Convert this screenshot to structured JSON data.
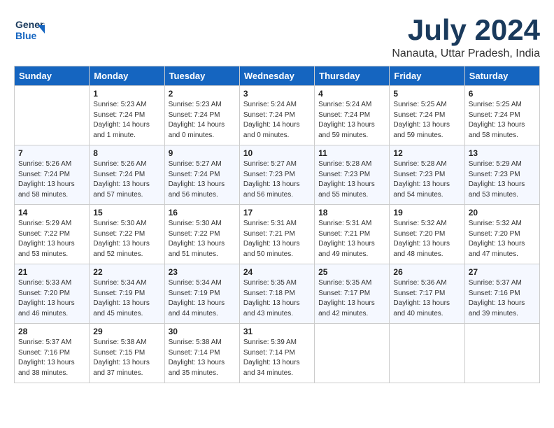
{
  "header": {
    "logo_line1": "General",
    "logo_line2": "Blue",
    "title": "July 2024",
    "subtitle": "Nanauta, Uttar Pradesh, India"
  },
  "columns": [
    "Sunday",
    "Monday",
    "Tuesday",
    "Wednesday",
    "Thursday",
    "Friday",
    "Saturday"
  ],
  "weeks": [
    [
      {
        "num": "",
        "sunrise": "",
        "sunset": "",
        "daylight": ""
      },
      {
        "num": "1",
        "sunrise": "Sunrise: 5:23 AM",
        "sunset": "Sunset: 7:24 PM",
        "daylight": "Daylight: 14 hours and 1 minute."
      },
      {
        "num": "2",
        "sunrise": "Sunrise: 5:23 AM",
        "sunset": "Sunset: 7:24 PM",
        "daylight": "Daylight: 14 hours and 0 minutes."
      },
      {
        "num": "3",
        "sunrise": "Sunrise: 5:24 AM",
        "sunset": "Sunset: 7:24 PM",
        "daylight": "Daylight: 14 hours and 0 minutes."
      },
      {
        "num": "4",
        "sunrise": "Sunrise: 5:24 AM",
        "sunset": "Sunset: 7:24 PM",
        "daylight": "Daylight: 13 hours and 59 minutes."
      },
      {
        "num": "5",
        "sunrise": "Sunrise: 5:25 AM",
        "sunset": "Sunset: 7:24 PM",
        "daylight": "Daylight: 13 hours and 59 minutes."
      },
      {
        "num": "6",
        "sunrise": "Sunrise: 5:25 AM",
        "sunset": "Sunset: 7:24 PM",
        "daylight": "Daylight: 13 hours and 58 minutes."
      }
    ],
    [
      {
        "num": "7",
        "sunrise": "Sunrise: 5:26 AM",
        "sunset": "Sunset: 7:24 PM",
        "daylight": "Daylight: 13 hours and 58 minutes."
      },
      {
        "num": "8",
        "sunrise": "Sunrise: 5:26 AM",
        "sunset": "Sunset: 7:24 PM",
        "daylight": "Daylight: 13 hours and 57 minutes."
      },
      {
        "num": "9",
        "sunrise": "Sunrise: 5:27 AM",
        "sunset": "Sunset: 7:24 PM",
        "daylight": "Daylight: 13 hours and 56 minutes."
      },
      {
        "num": "10",
        "sunrise": "Sunrise: 5:27 AM",
        "sunset": "Sunset: 7:23 PM",
        "daylight": "Daylight: 13 hours and 56 minutes."
      },
      {
        "num": "11",
        "sunrise": "Sunrise: 5:28 AM",
        "sunset": "Sunset: 7:23 PM",
        "daylight": "Daylight: 13 hours and 55 minutes."
      },
      {
        "num": "12",
        "sunrise": "Sunrise: 5:28 AM",
        "sunset": "Sunset: 7:23 PM",
        "daylight": "Daylight: 13 hours and 54 minutes."
      },
      {
        "num": "13",
        "sunrise": "Sunrise: 5:29 AM",
        "sunset": "Sunset: 7:23 PM",
        "daylight": "Daylight: 13 hours and 53 minutes."
      }
    ],
    [
      {
        "num": "14",
        "sunrise": "Sunrise: 5:29 AM",
        "sunset": "Sunset: 7:22 PM",
        "daylight": "Daylight: 13 hours and 53 minutes."
      },
      {
        "num": "15",
        "sunrise": "Sunrise: 5:30 AM",
        "sunset": "Sunset: 7:22 PM",
        "daylight": "Daylight: 13 hours and 52 minutes."
      },
      {
        "num": "16",
        "sunrise": "Sunrise: 5:30 AM",
        "sunset": "Sunset: 7:22 PM",
        "daylight": "Daylight: 13 hours and 51 minutes."
      },
      {
        "num": "17",
        "sunrise": "Sunrise: 5:31 AM",
        "sunset": "Sunset: 7:21 PM",
        "daylight": "Daylight: 13 hours and 50 minutes."
      },
      {
        "num": "18",
        "sunrise": "Sunrise: 5:31 AM",
        "sunset": "Sunset: 7:21 PM",
        "daylight": "Daylight: 13 hours and 49 minutes."
      },
      {
        "num": "19",
        "sunrise": "Sunrise: 5:32 AM",
        "sunset": "Sunset: 7:20 PM",
        "daylight": "Daylight: 13 hours and 48 minutes."
      },
      {
        "num": "20",
        "sunrise": "Sunrise: 5:32 AM",
        "sunset": "Sunset: 7:20 PM",
        "daylight": "Daylight: 13 hours and 47 minutes."
      }
    ],
    [
      {
        "num": "21",
        "sunrise": "Sunrise: 5:33 AM",
        "sunset": "Sunset: 7:20 PM",
        "daylight": "Daylight: 13 hours and 46 minutes."
      },
      {
        "num": "22",
        "sunrise": "Sunrise: 5:34 AM",
        "sunset": "Sunset: 7:19 PM",
        "daylight": "Daylight: 13 hours and 45 minutes."
      },
      {
        "num": "23",
        "sunrise": "Sunrise: 5:34 AM",
        "sunset": "Sunset: 7:19 PM",
        "daylight": "Daylight: 13 hours and 44 minutes."
      },
      {
        "num": "24",
        "sunrise": "Sunrise: 5:35 AM",
        "sunset": "Sunset: 7:18 PM",
        "daylight": "Daylight: 13 hours and 43 minutes."
      },
      {
        "num": "25",
        "sunrise": "Sunrise: 5:35 AM",
        "sunset": "Sunset: 7:17 PM",
        "daylight": "Daylight: 13 hours and 42 minutes."
      },
      {
        "num": "26",
        "sunrise": "Sunrise: 5:36 AM",
        "sunset": "Sunset: 7:17 PM",
        "daylight": "Daylight: 13 hours and 40 minutes."
      },
      {
        "num": "27",
        "sunrise": "Sunrise: 5:37 AM",
        "sunset": "Sunset: 7:16 PM",
        "daylight": "Daylight: 13 hours and 39 minutes."
      }
    ],
    [
      {
        "num": "28",
        "sunrise": "Sunrise: 5:37 AM",
        "sunset": "Sunset: 7:16 PM",
        "daylight": "Daylight: 13 hours and 38 minutes."
      },
      {
        "num": "29",
        "sunrise": "Sunrise: 5:38 AM",
        "sunset": "Sunset: 7:15 PM",
        "daylight": "Daylight: 13 hours and 37 minutes."
      },
      {
        "num": "30",
        "sunrise": "Sunrise: 5:38 AM",
        "sunset": "Sunset: 7:14 PM",
        "daylight": "Daylight: 13 hours and 35 minutes."
      },
      {
        "num": "31",
        "sunrise": "Sunrise: 5:39 AM",
        "sunset": "Sunset: 7:14 PM",
        "daylight": "Daylight: 13 hours and 34 minutes."
      },
      {
        "num": "",
        "sunrise": "",
        "sunset": "",
        "daylight": ""
      },
      {
        "num": "",
        "sunrise": "",
        "sunset": "",
        "daylight": ""
      },
      {
        "num": "",
        "sunrise": "",
        "sunset": "",
        "daylight": ""
      }
    ]
  ]
}
